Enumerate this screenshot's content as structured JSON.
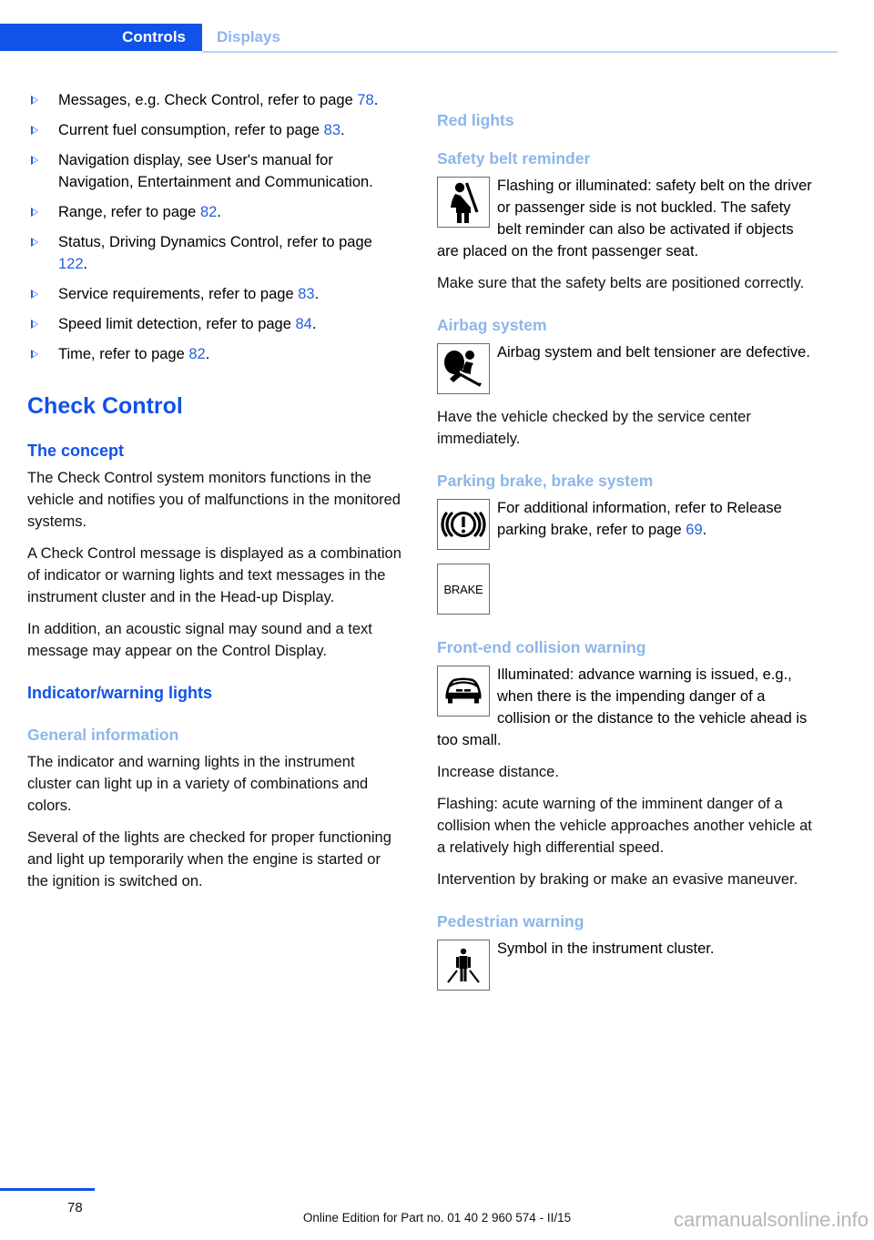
{
  "header": {
    "active_tab": "Controls",
    "inactive_tab": "Displays",
    "accent_color": "#1152e8",
    "muted_accent_color": "#8cb6e8"
  },
  "left_column": {
    "bullets": [
      {
        "text_before": "Messages, e.g. Check Control, refer to page ",
        "page": "78",
        "text_after": "."
      },
      {
        "text_before": "Current fuel consumption, refer to page ",
        "page": "83",
        "text_after": "."
      },
      {
        "text_before": "Navigation display, see User's manual for Navigation, Entertainment and Communication.",
        "page": "",
        "text_after": ""
      },
      {
        "text_before": "Range, refer to page ",
        "page": "82",
        "text_after": "."
      },
      {
        "text_before": "Status, Driving Dynamics Control, refer to page ",
        "page": "122",
        "text_after": "."
      },
      {
        "text_before": "Service requirements, refer to page ",
        "page": "83",
        "text_after": "."
      },
      {
        "text_before": "Speed limit detection, refer to page ",
        "page": "84",
        "text_after": "."
      },
      {
        "text_before": "Time, refer to page ",
        "page": "82",
        "text_after": "."
      }
    ],
    "check_control_heading": "Check Control",
    "the_concept_heading": "The concept",
    "concept_p1": "The Check Control system monitors functions in the vehicle and notifies you of malfunctions in the monitored systems.",
    "concept_p2": "A Check Control message is displayed as a combination of indicator or warning lights and text messages in the instrument cluster and in the Head-up Display.",
    "concept_p3": "In addition, an acoustic signal may sound and a text message may appear on the Control Display.",
    "indicator_warning_heading": "Indicator/warning lights",
    "general_information_heading": "General information",
    "general_p1": "The indicator and warning lights in the instrument cluster can light up in a variety of combinations and colors.",
    "general_p2": "Several of the lights are checked for proper functioning and light up temporarily when the engine is started or the ignition is switched on."
  },
  "right_column": {
    "red_lights_heading": "Red lights",
    "safety_belt": {
      "heading": "Safety belt reminder",
      "icon": "seatbelt-reminder-icon",
      "p1": "Flashing or illuminated: safety belt on the driver or passenger side is not buckled. The safety belt reminder can also be activated if objects are placed on the front passenger seat.",
      "p2": "Make sure that the safety belts are positioned correctly."
    },
    "airbag": {
      "heading": "Airbag system",
      "icon": "airbag-system-icon",
      "p1": "Airbag system and belt tensioner are defective.",
      "p2": "Have the vehicle checked by the service center immediately."
    },
    "parking_brake": {
      "heading": "Parking brake, brake system",
      "icon": "brake-warning-icon",
      "icon2_label": "BRAKE",
      "text_before": "For additional information, refer to Release parking brake, refer to page ",
      "page": "69",
      "text_after": "."
    },
    "collision": {
      "heading": "Front-end collision warning",
      "icon": "front-car-icon",
      "p1": "Illuminated: advance warning is issued, e.g., when there is the impending danger of a collision or the distance to the vehicle ahead is too small.",
      "p2": "Increase distance.",
      "p3": "Flashing: acute warning of the imminent danger of a collision when the vehicle approaches another vehicle at a relatively high differential speed.",
      "p4": "Intervention by braking or make an evasive maneuver."
    },
    "pedestrian": {
      "heading": "Pedestrian warning",
      "icon": "pedestrian-warning-icon",
      "p1": "Symbol in the instrument cluster."
    }
  },
  "footer": {
    "page_number": "78",
    "edition": "Online Edition for Part no. 01 40 2 960 574 - II/15",
    "watermark": "carmanualsonline.info"
  }
}
